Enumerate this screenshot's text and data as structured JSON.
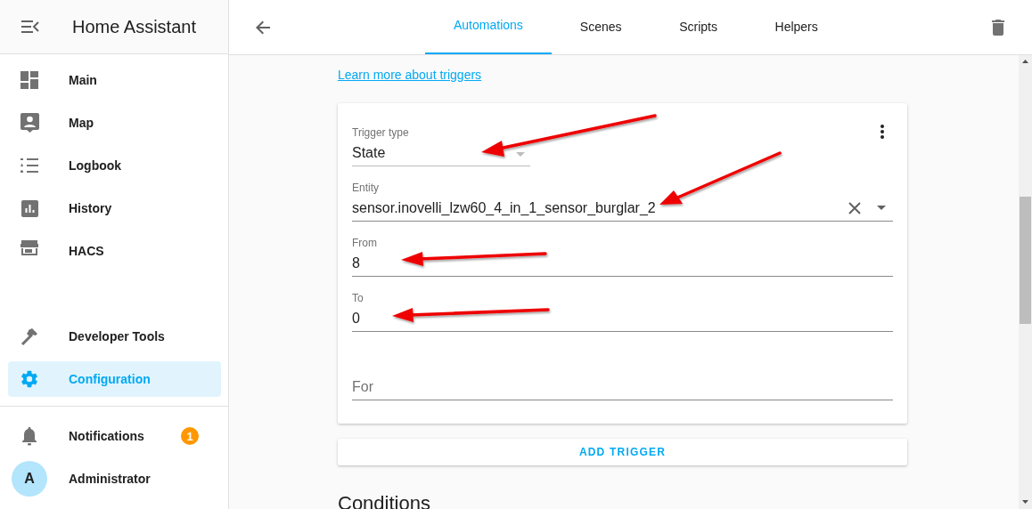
{
  "sidebar": {
    "title": "Home Assistant",
    "panels": [
      {
        "label": "Main",
        "selected": false
      },
      {
        "label": "Map",
        "selected": false
      },
      {
        "label": "Logbook",
        "selected": false
      },
      {
        "label": "History",
        "selected": false
      },
      {
        "label": "HACS",
        "selected": false
      }
    ],
    "tools": [
      {
        "label": "Developer Tools",
        "selected": false
      },
      {
        "label": "Configuration",
        "selected": true
      }
    ],
    "notifications": {
      "label": "Notifications",
      "badge": "1"
    },
    "user": {
      "initial": "A",
      "name": "Administrator"
    }
  },
  "toolbar": {
    "tabs": [
      {
        "label": "Automations",
        "selected": true
      },
      {
        "label": "Scenes",
        "selected": false
      },
      {
        "label": "Scripts",
        "selected": false
      },
      {
        "label": "Helpers",
        "selected": false
      }
    ]
  },
  "content": {
    "link": "Learn more about triggers",
    "trigger": {
      "fields": [
        {
          "kind": "select",
          "label": "Trigger type",
          "value": "State"
        },
        {
          "kind": "combo",
          "label": "Entity",
          "value": "sensor.inovelli_lzw60_4_in_1_sensor_burglar_2"
        },
        {
          "kind": "text",
          "label": "From",
          "value": "8"
        },
        {
          "kind": "text",
          "label": "To",
          "value": "0"
        },
        {
          "kind": "text",
          "placeholder": "For"
        }
      ]
    },
    "add_button": "ADD TRIGGER",
    "heading": "Conditions"
  }
}
